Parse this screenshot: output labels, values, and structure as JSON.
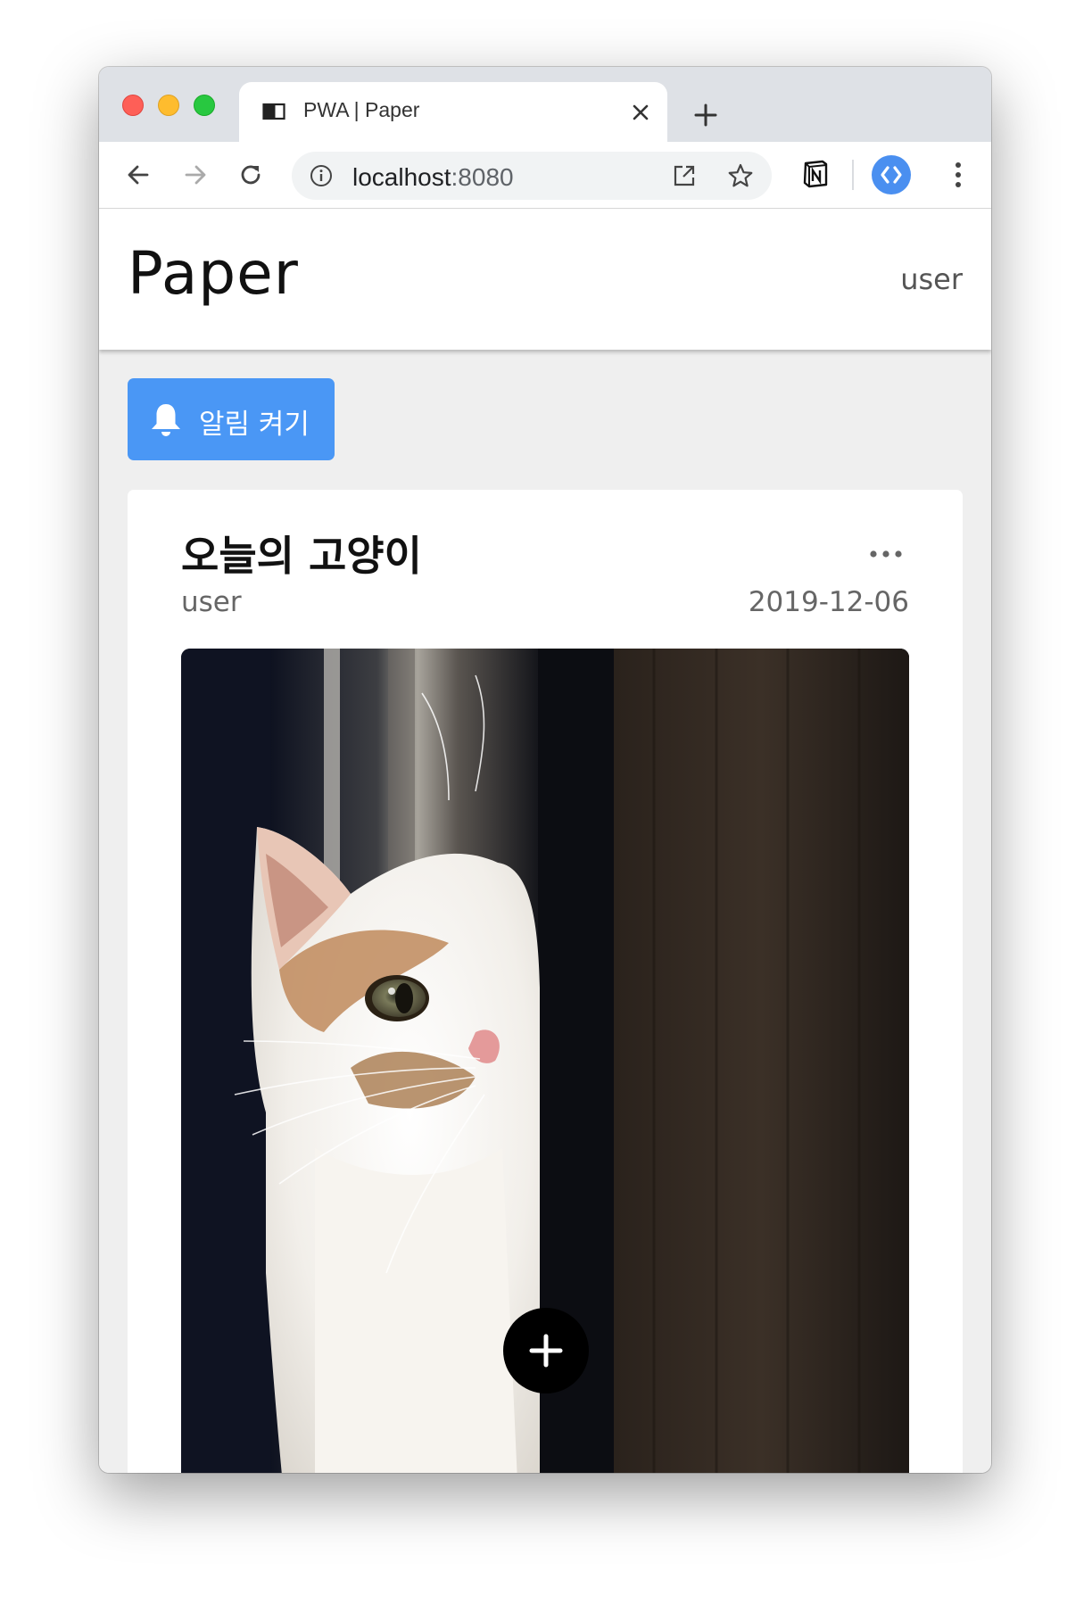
{
  "browser": {
    "tab": {
      "title": "PWA | Paper",
      "favicon": "book-icon",
      "close": "close-icon"
    },
    "new_tab": "plus-icon",
    "toolbar": {
      "back": "arrow-left-icon",
      "forward": "arrow-right-icon",
      "reload": "reload-icon",
      "url_host": "localhost",
      "url_port": ":8080",
      "site_info": "info-icon",
      "open_in_app": "open-external-icon",
      "bookmark": "star-icon",
      "extensions": [
        "notion-icon",
        "code-brackets-icon"
      ],
      "menu": "more-vertical-icon"
    },
    "accent": "#4a8ff0"
  },
  "app": {
    "brand": "Paper",
    "header_user": "user",
    "notify_button": {
      "label": "알림 켜기",
      "icon": "bell-icon",
      "color": "#4a97f5"
    },
    "posts": [
      {
        "title": "오늘의 고양이",
        "author": "user",
        "date": "2019-12-06",
        "more_icon": "more-horizontal-icon",
        "image": "cat-photo"
      }
    ],
    "fab_icon": "plus-icon"
  }
}
